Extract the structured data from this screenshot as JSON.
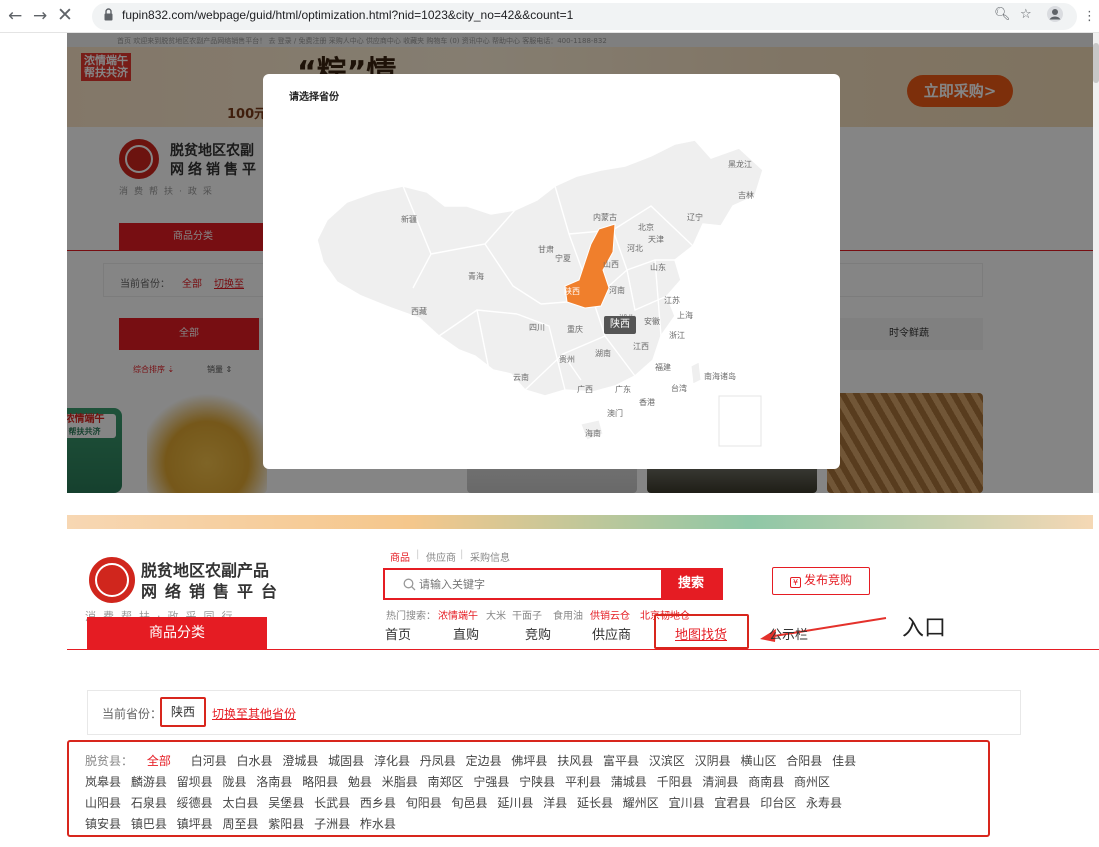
{
  "browser": {
    "url": "fupin832.com/webpage/guid/html/optimization.html?nid=1023&city_no=42&&count=1"
  },
  "shot1": {
    "top_strip": "首页 欢迎来到脱贫地区农副产品网络销售平台！ 去 登录 / 免费注册      采购人中心  供应商中心  收藏夹  购物车 (0)  资讯中心  帮助中心  客服电话：400-1188-832",
    "banner_tag": [
      "浓情端午",
      "帮扶共济"
    ],
    "banner_price_fragment": "100元",
    "banner_slogan_fragment": "“粽”情",
    "buy_now": "立即采购>",
    "logo_title_1": "脱贫地区农副",
    "logo_title_2": "网络销售平",
    "logo_sub": "消费帮扶·政采",
    "category_btn": "商品分类",
    "province_label": "当前省份：",
    "province_all": "全部",
    "province_switch": "切换至",
    "tab_all": "全部",
    "tab_fresh": "时令鲜蔬",
    "sort_a": "综合排序 ⇣",
    "sort_b": "销量 ⇕",
    "side_tag": [
      "浓情端午",
      "帮扶共济"
    ],
    "modal": {
      "title": "请选择省份",
      "tooltip": "陕西",
      "provinces": [
        "黑龙江",
        "吉林",
        "辽宁",
        "内蒙古",
        "北京",
        "天津",
        "河北",
        "新疆",
        "甘肃",
        "宁夏",
        "山西",
        "山东",
        "青海",
        "陕西",
        "河南",
        "江苏",
        "西藏",
        "四川",
        "重庆",
        "安徽",
        "上海",
        "湖北",
        "浙江",
        "江西",
        "湖南",
        "贵州",
        "福建",
        "云南",
        "广西",
        "广东",
        "台湾",
        "南海诸岛",
        "香港",
        "澳门",
        "海南"
      ]
    }
  },
  "shot2": {
    "logo_title_1": "脱贫地区农副产品",
    "logo_title_2": "网络销售平台",
    "logo_sub": "消费帮扶·政采同行",
    "search_tabs": [
      "商品",
      "供应商",
      "采购信息"
    ],
    "search_placeholder": "请输入关键字",
    "search_btn": "搜索",
    "publish_btn": "发布竞购",
    "hot_label": "热门搜索：",
    "hot_items": [
      "浓情端午",
      "大米",
      "干面子",
      "食用油",
      "供销云仓",
      "北京韧地仓"
    ],
    "annotation": "入口",
    "category_btn": "商品分类",
    "nav": [
      "首页",
      "直购",
      "竞购",
      "供应商",
      "地图找货",
      "公示栏"
    ],
    "province_label": "当前省份：",
    "province_current": "陕西",
    "province_switch": "切换至其他省份",
    "county_label": "脱贫县：",
    "county_all": "全部",
    "county_rows": [
      "白河县 白水县 澄城县 城固县 淳化县 丹凤县 定边县 佛坪县 扶风县 富平县 汉滨区 汉阴县 横山区 合阳县 佳县",
      "岚皋县 麟游县 留坝县 陇县 洛南县 略阳县 勉县 米脂县 南郑区 宁强县 宁陕县 平利县 蒲城县 千阳县 清涧县 商南县 商州区",
      "山阳县 石泉县 绥德县 太白县 吴堡县 长武县 西乡县 旬阳县 旬邑县 延川县 洋县 延长县 耀州区 宜川县 宜君县 印台区 永寿县",
      "镇安县 镇巴县 镇坪县 周至县 紫阳县 子洲县 柞水县"
    ]
  }
}
